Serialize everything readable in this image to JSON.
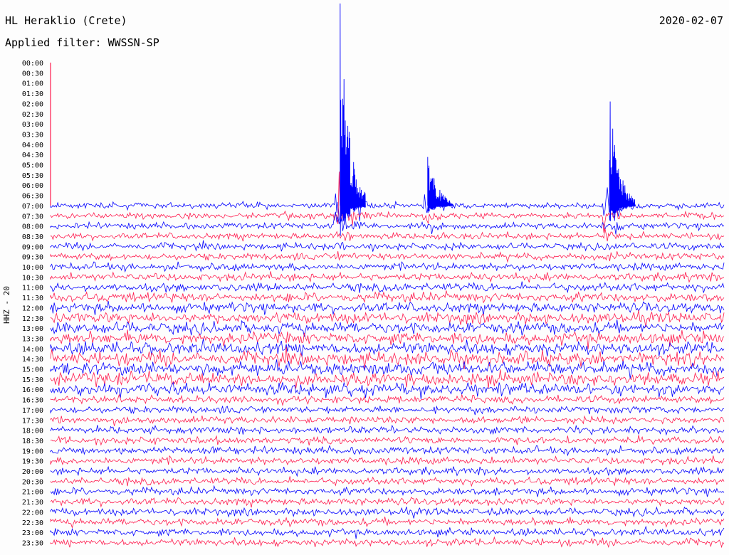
{
  "header": {
    "title": "HL Heraklio (Crete)",
    "filter": "Applied filter: WWSSN-SP",
    "date": "2020-02-07",
    "channel": "HHZ - 20"
  },
  "colors": {
    "trace_a": "#0000ff",
    "trace_b": "#ff1a4d",
    "background": "#fdfdfd"
  },
  "chart_data": {
    "type": "line",
    "title": "HL Heraklio (Crete)",
    "subtitle": "Applied filter: WWSSN-SP",
    "ylabel": "HHZ - 20",
    "y_tick_labels": [
      "00:00",
      "00:30",
      "01:00",
      "01:30",
      "02:00",
      "02:30",
      "03:00",
      "03:30",
      "04:00",
      "04:30",
      "05:00",
      "05:30",
      "06:00",
      "06:30",
      "07:00",
      "07:30",
      "08:00",
      "08:30",
      "09:00",
      "09:30",
      "10:00",
      "10:30",
      "11:00",
      "11:30",
      "12:00",
      "12:30",
      "13:00",
      "13:30",
      "14:00",
      "14:30",
      "15:00",
      "15:30",
      "16:00",
      "16:30",
      "17:00",
      "17:30",
      "18:00",
      "18:30",
      "19:00",
      "19:30",
      "20:00",
      "20:30",
      "21:00",
      "21:30",
      "22:00",
      "22:30",
      "23:00",
      "23:30"
    ],
    "trace_colors_alternating": [
      "#0000ff",
      "#ff1a4d"
    ],
    "first_trace_hour": "07:00",
    "events": [
      {
        "time": "07:00",
        "x_fraction": 0.43,
        "amplitude": "very-large",
        "description_label": ""
      },
      {
        "time": "07:00",
        "x_fraction": 0.56,
        "amplitude": "medium"
      },
      {
        "time": "07:00",
        "x_fraction": 0.83,
        "amplitude": "large"
      }
    ]
  }
}
